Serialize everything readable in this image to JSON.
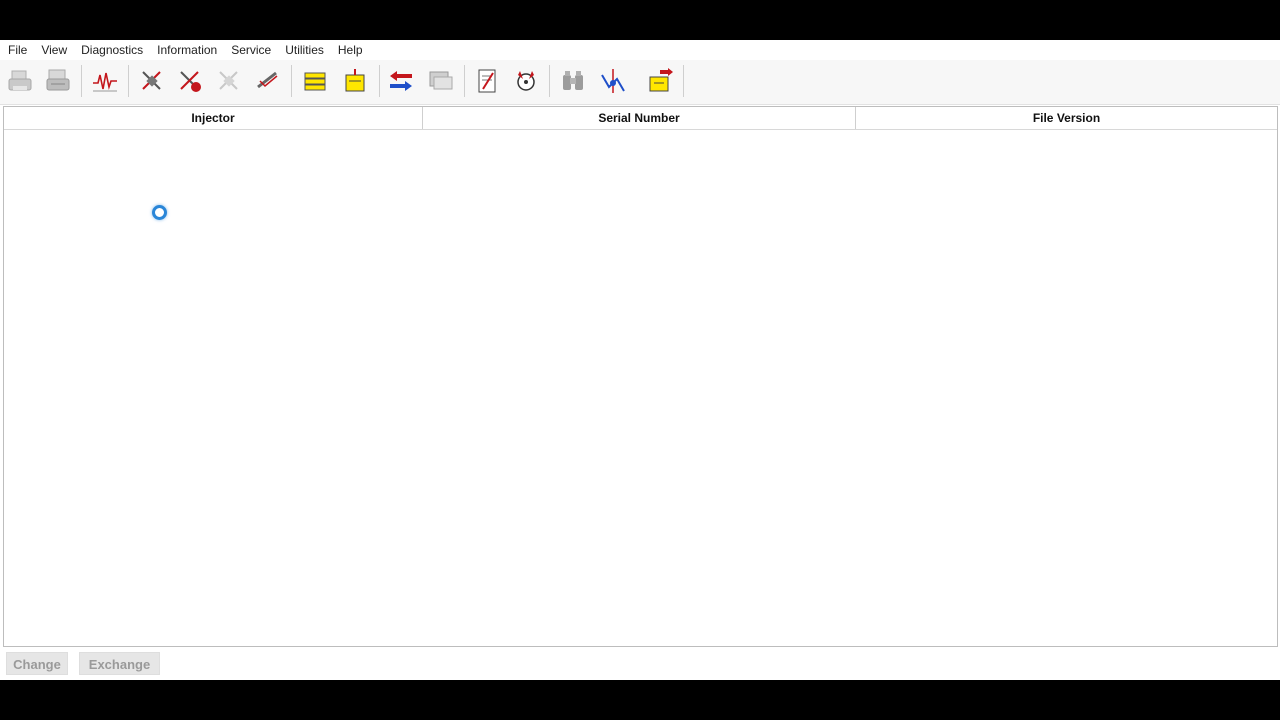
{
  "menu": {
    "items": [
      {
        "label": "File"
      },
      {
        "label": "View"
      },
      {
        "label": "Diagnostics"
      },
      {
        "label": "Information"
      },
      {
        "label": "Service"
      },
      {
        "label": "Utilities"
      },
      {
        "label": "Help"
      }
    ]
  },
  "toolbar": {
    "icons": [
      "print-icon",
      "print-preview-icon",
      "waveform-icon",
      "injector-test-icon",
      "injector-test-alt-icon",
      "injector-disabled-icon",
      "injector-check-icon",
      "module-stack-icon",
      "module-yellow-icon",
      "transfer-arrows-icon",
      "screen-capture-icon",
      "notepad-icon",
      "calibration-icon",
      "binoculars-icon",
      "graph-cursor-icon",
      "export-yellow-icon"
    ]
  },
  "grid": {
    "columns": [
      "Injector",
      "Serial Number",
      "File Version"
    ]
  },
  "buttons": {
    "change_label": "Change",
    "exchange_label": "Exchange"
  },
  "status": {
    "loading": true
  },
  "colors": {
    "accent_red": "#c4161c",
    "accent_blue": "#1f4fc9",
    "accent_yellow": "#ffe600",
    "spinner_blue": "#2a86d8"
  }
}
